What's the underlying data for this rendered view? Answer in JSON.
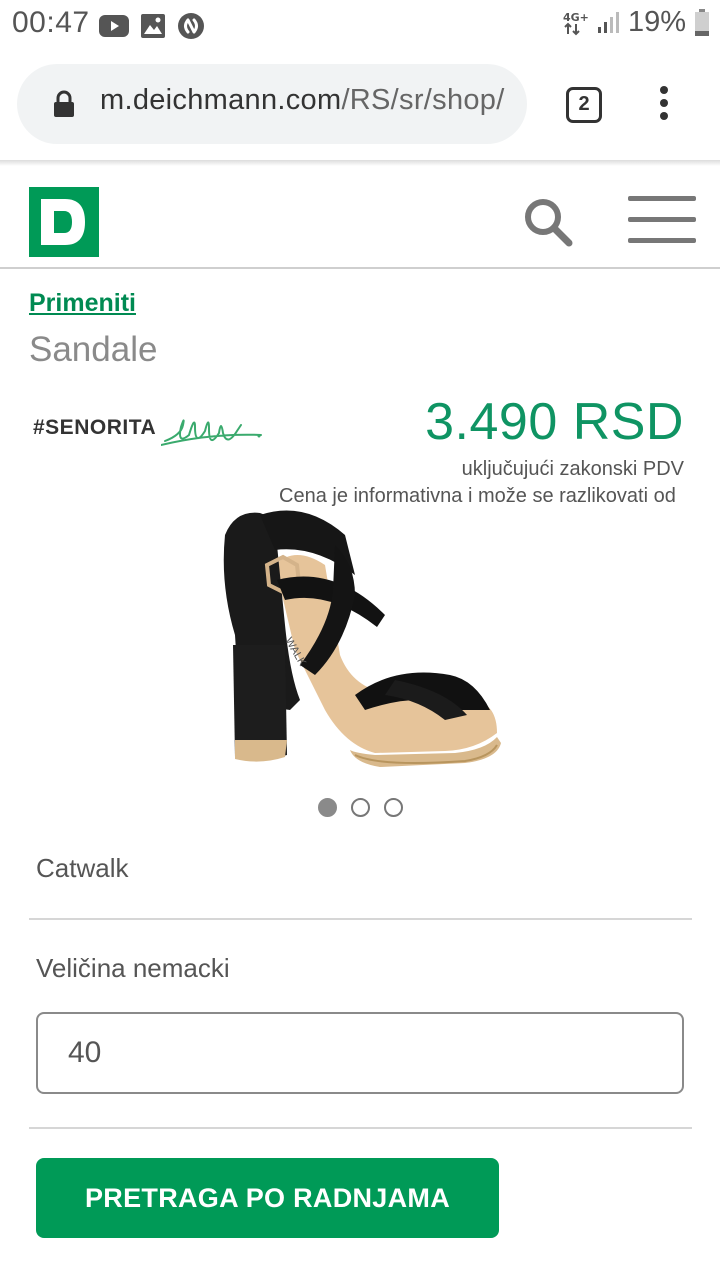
{
  "status_bar": {
    "time": "00:47",
    "network": "4G+",
    "battery": "19%",
    "icons": [
      "youtube-icon",
      "image-icon",
      "shazam-icon",
      "signal-icon",
      "battery-icon"
    ]
  },
  "browser": {
    "url_host": "m.deichmann.com",
    "url_path": "/RS/sr/shop/",
    "tab_count": "2"
  },
  "header": {
    "logo_letter": "D",
    "brand_color": "#009a57"
  },
  "breadcrumb": "Primeniti",
  "category": "Sandale",
  "senorita": {
    "tag": "#SENORITA"
  },
  "price": {
    "amount": "3.490 RSD",
    "vat_note": "uključujući zakonski PDV",
    "disclaimer": "Cena je informativna i može se razlikovati od"
  },
  "carousel": {
    "count": 3,
    "active": 0
  },
  "product": {
    "brand": "Catwalk",
    "size_label": "Veličina nemacki",
    "size_value": "40",
    "cta_label": "PRETRAGA PO RADNJAMA",
    "image_text": "WALK"
  },
  "colors": {
    "accent": "#009a57",
    "price": "#0f9463"
  }
}
